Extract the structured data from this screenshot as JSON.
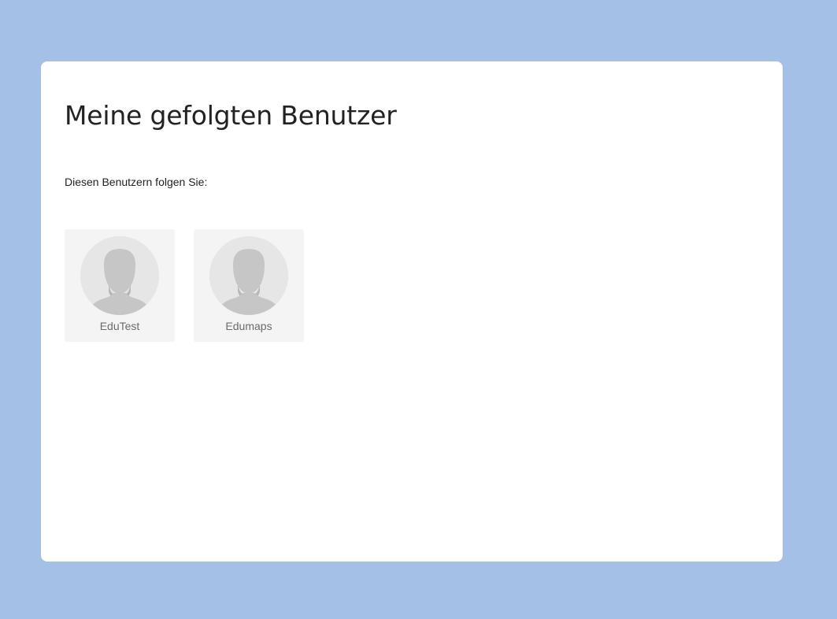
{
  "page": {
    "title": "Meine gefolgten Benutzer",
    "intro": "Diesen Benutzern folgen Sie:"
  },
  "users": [
    {
      "name": "EduTest",
      "avatar_icon": "default-user-silhouette-icon"
    },
    {
      "name": "Edumaps",
      "avatar_icon": "default-user-silhouette-icon"
    }
  ],
  "colors": {
    "background": "#a5c0e7",
    "card": "#ffffff",
    "tile": "#f4f4f4",
    "avatar_bg": "#e6e6e6",
    "silhouette": "#c6c6c6",
    "silhouette_shadow": "#b8b8b8",
    "title_text": "#222222",
    "name_text": "#6b6b6b"
  }
}
